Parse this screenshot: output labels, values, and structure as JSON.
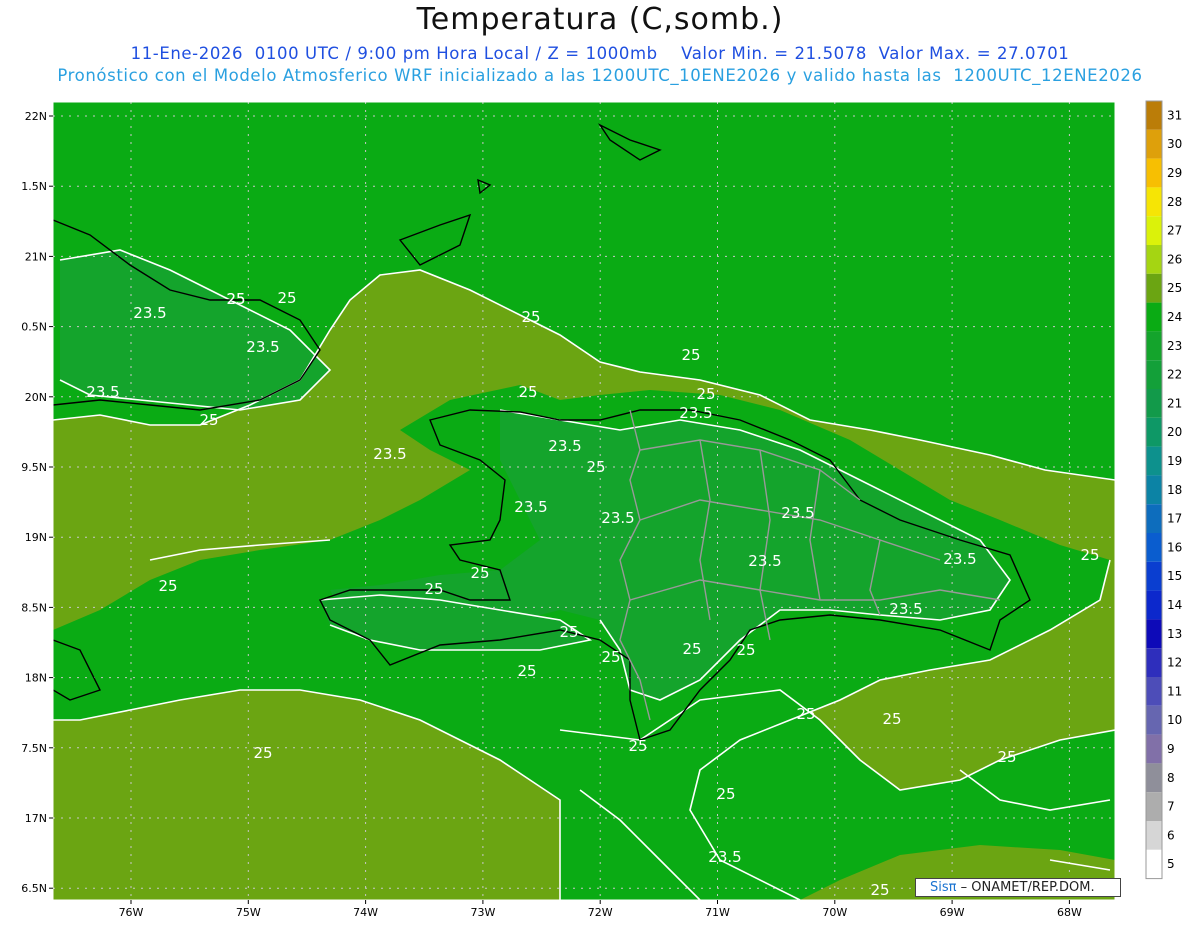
{
  "header": {
    "title": "Temperatura (C,somb.)",
    "subtitle": "11-Ene-2026  0100 UTC / 9:00 pm Hora Local / Z = 1000mb    Valor Min. = 21.5078  Valor Max. = 27.0701",
    "subtitle2": "Pronóstico con el Modelo Atmosferico WRF inicializado a las 1200UTC_10ENE2026 y valido hasta las  1200UTC_12ENE2026"
  },
  "map": {
    "lat_labels": [
      "22N",
      "1.5N",
      "21N",
      "0.5N",
      "20N",
      "9.5N",
      "19N",
      "8.5N",
      "18N",
      "7.5N",
      "17N",
      "6.5N"
    ],
    "lon_labels": [
      "76W",
      "75W",
      "74W",
      "73W",
      "72W",
      "71W",
      "70W",
      "69W",
      "68W"
    ],
    "contour_labels": [
      "25",
      "25",
      "23.5",
      "23.5",
      "23.5",
      "25",
      "25",
      "25",
      "25",
      "25",
      "23.5",
      "23.5",
      "23.5",
      "25",
      "23.5",
      "23.5",
      "23.5",
      "23.5",
      "23.5",
      "23.5",
      "25",
      "25",
      "25",
      "25",
      "25",
      "25",
      "25",
      "25",
      "25",
      "25",
      "25",
      "25",
      "25",
      "25",
      "25",
      "23.5",
      "25",
      "25"
    ],
    "colors": {
      "band_23": "#14a42c",
      "band_24": "#0aab14",
      "band_25": "#6ba512",
      "contour": "#ffffff",
      "coastline": "#000000",
      "borders": "#999999",
      "gridline": "#b0b0b0"
    }
  },
  "colorbar": {
    "labels": [
      "31",
      "30",
      "29",
      "28",
      "27",
      "26",
      "25",
      "24",
      "23",
      "22",
      "21",
      "20",
      "19",
      "18",
      "17",
      "16",
      "15",
      "14",
      "13",
      "12",
      "11",
      "10",
      "9",
      "8",
      "7",
      "6",
      "5"
    ],
    "colors": [
      "#bb7d08",
      "#dea00b",
      "#f7bf02",
      "#f6e505",
      "#dbf20a",
      "#a5d512",
      "#6ba512",
      "#0aab14",
      "#14a42c",
      "#13a039",
      "#129a4a",
      "#0e9866",
      "#0d918d",
      "#0c83a5",
      "#0d6dbd",
      "#0a5dcf",
      "#0a3ed0",
      "#0c28cc",
      "#0d0ab8",
      "#2e2ebc",
      "#4d4db8",
      "#6666b0",
      "#8170a8",
      "#8f8f9a",
      "#adadad",
      "#d6d6d6",
      "#ffffff"
    ]
  },
  "credit": {
    "brand": "Sisπ",
    "org": " – ONAMET/REP.DOM."
  }
}
